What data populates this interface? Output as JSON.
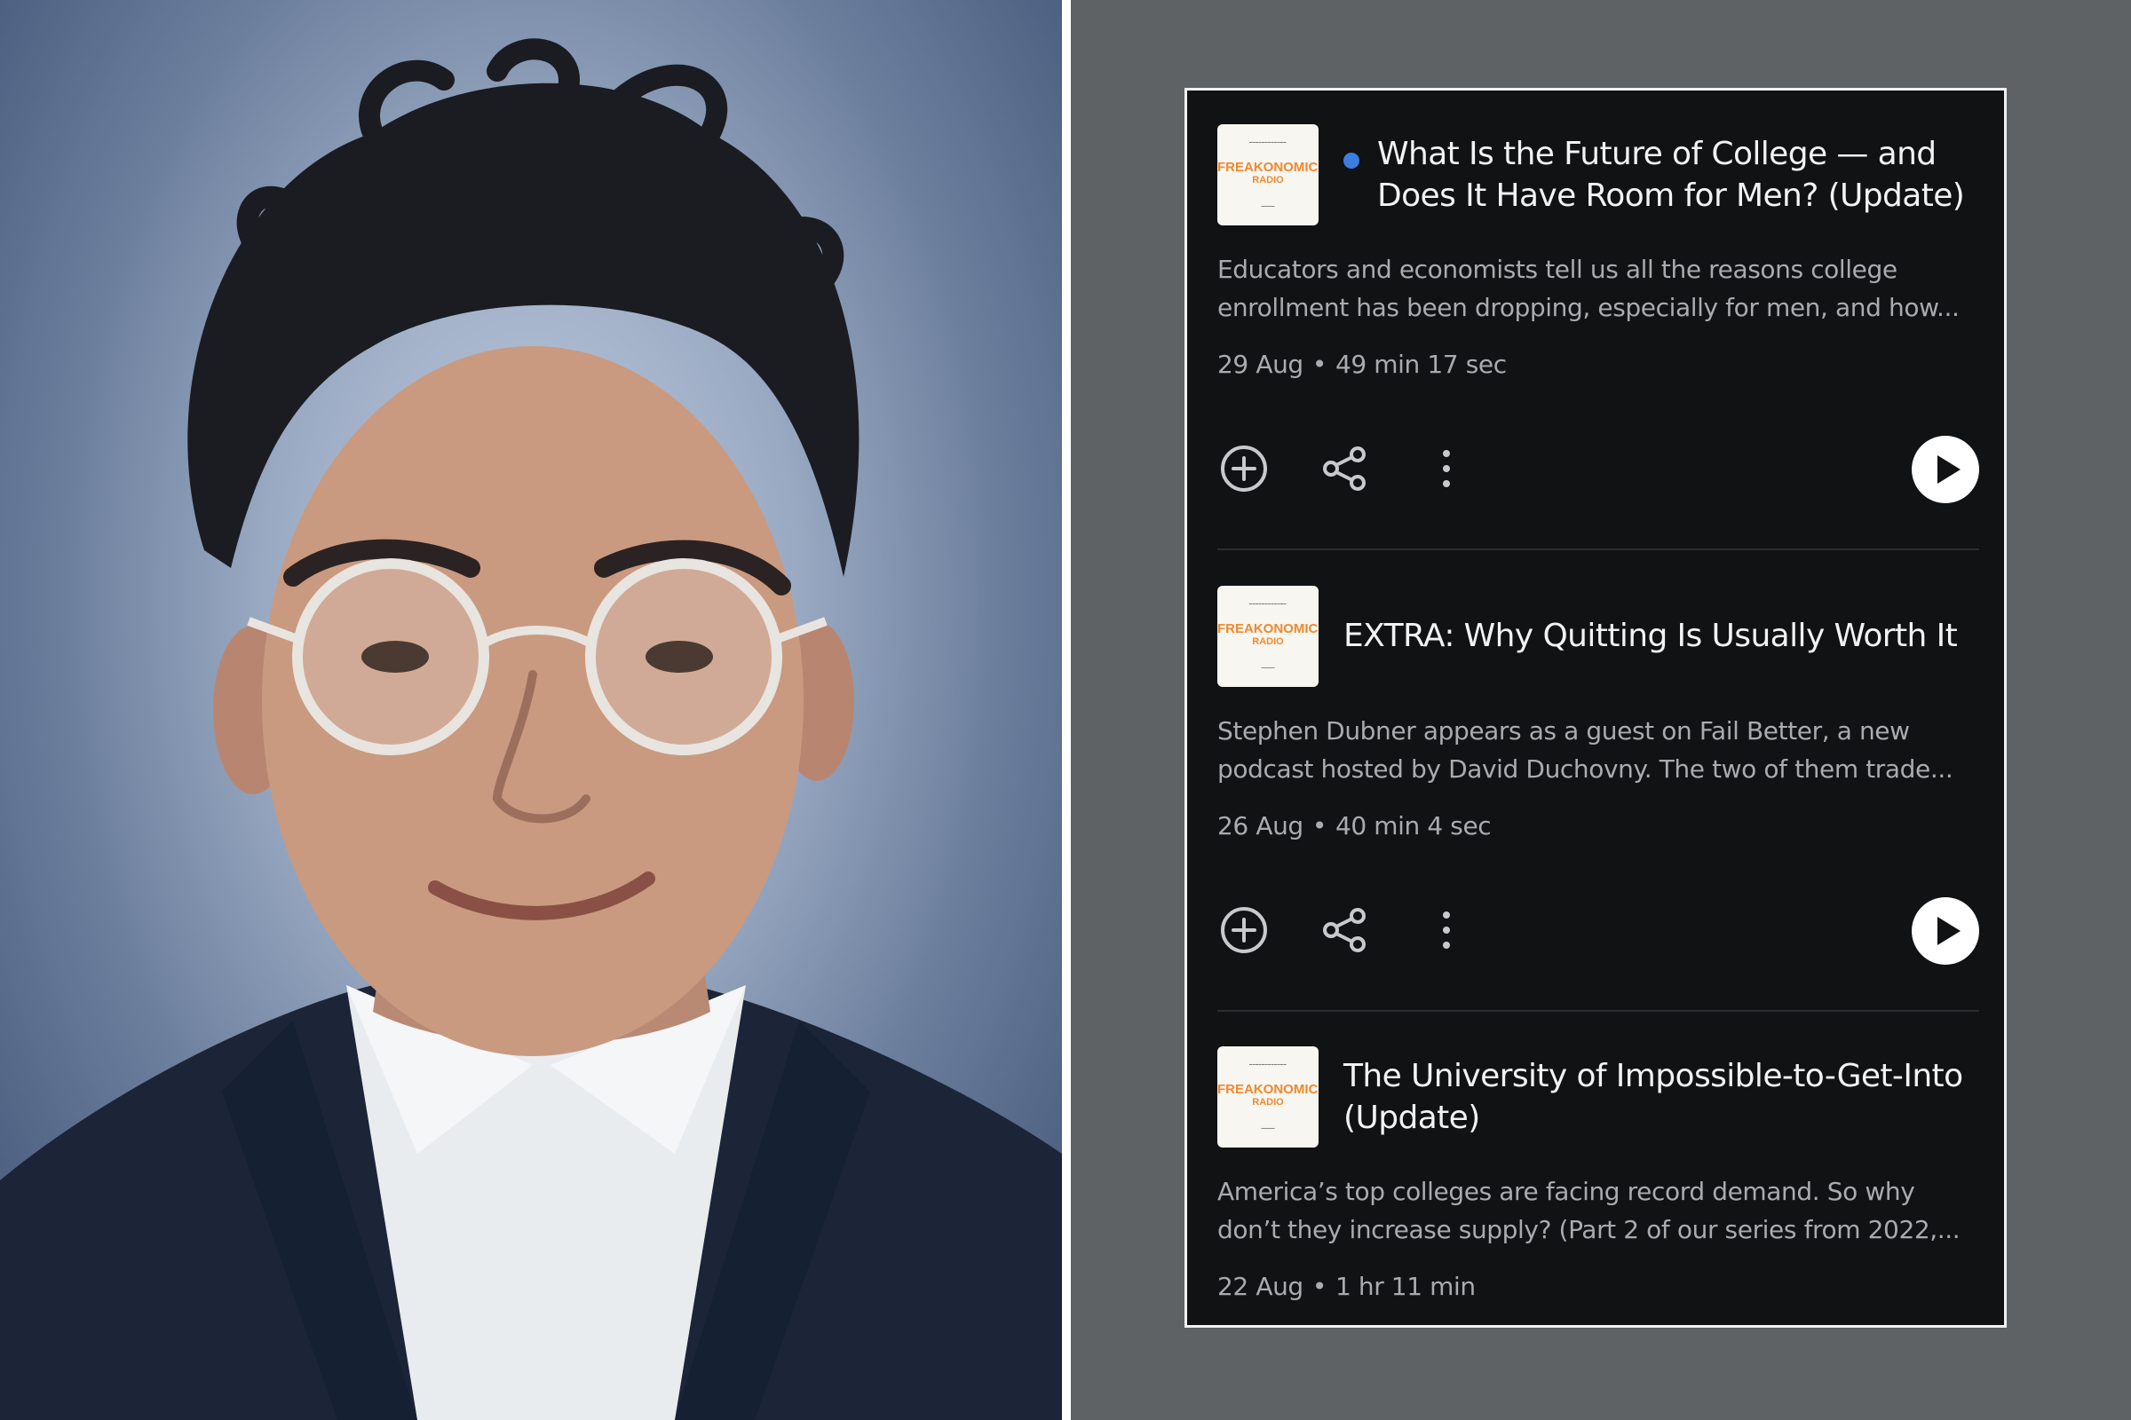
{
  "episodes": [
    {
      "title_lines": [
        "What Is the Future of College — and",
        "Does It Have Room for Men? (Update)"
      ],
      "description_lines": [
        "Educators and economists tell us all the reasons college",
        "enrollment has been dropping, especially for men, and how..."
      ],
      "date": "29 Aug",
      "separator": "•",
      "duration": "49 min 17 sec",
      "unread": true,
      "show_actions": true
    },
    {
      "title_lines": [
        "EXTRA: Why Quitting Is Usually Worth It"
      ],
      "description_lines": [
        "Stephen Dubner appears as a guest on Fail Better, a new",
        "podcast hosted by David Duchovny. The two of them trade..."
      ],
      "date": "26 Aug",
      "separator": "•",
      "duration": "40 min 4 sec",
      "unread": false,
      "show_actions": true
    },
    {
      "title_lines": [
        "The University of Impossible-to-Get-Into",
        "(Update)"
      ],
      "description_lines": [
        "America’s top colleges are facing record demand. So why",
        "don’t they increase supply? (Part 2 of our series from 2022,..."
      ],
      "date": "22 Aug",
      "separator": "•",
      "duration": "1 hr 11 min",
      "unread": false,
      "show_actions": false
    }
  ],
  "artwork": {
    "logo_line1": "FREAKONOMICS",
    "logo_line2": "RADIO"
  },
  "icons": {
    "add": "add-to-queue-icon",
    "share": "share-icon",
    "more": "more-vert-icon",
    "play": "play-icon"
  },
  "colors": {
    "card_bg": "#111214",
    "unread_dot": "#3a7ee0",
    "artwork_accent": "#f0892e",
    "page_bg": "#5f6264"
  }
}
